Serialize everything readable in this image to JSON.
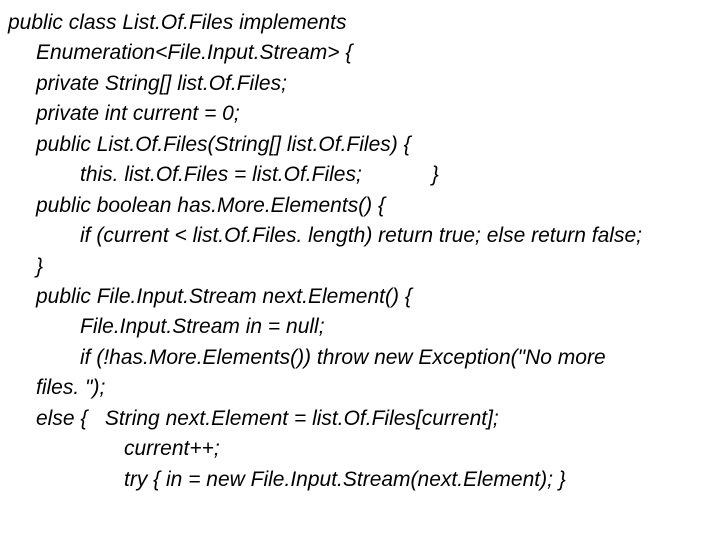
{
  "code": {
    "line1": "public class List.Of.Files implements",
    "line2": "Enumeration<File.Input.Stream> {",
    "line3": "private String[] list.Of.Files;",
    "line4": "private int current = 0;",
    "line5": "public List.Of.Files(String[] list.Of.Files) {",
    "line6": "this. list.Of.Files = list.Of.Files;            }",
    "line7": "public boolean has.More.Elements() {",
    "line8": "if (current < list.Of.Files. length) return true; else return false;",
    "line9": "}",
    "line10": "public File.Input.Stream next.Element() {",
    "line11": "File.Input.Stream in = null;",
    "line12": "if (!has.More.Elements()) throw new Exception(\"No more",
    "line12b": "files. \");",
    "line13": "else {   String next.Element = list.Of.Files[current];",
    "line14": "current++;",
    "line15": "try { in = new File.Input.Stream(next.Element); }"
  }
}
